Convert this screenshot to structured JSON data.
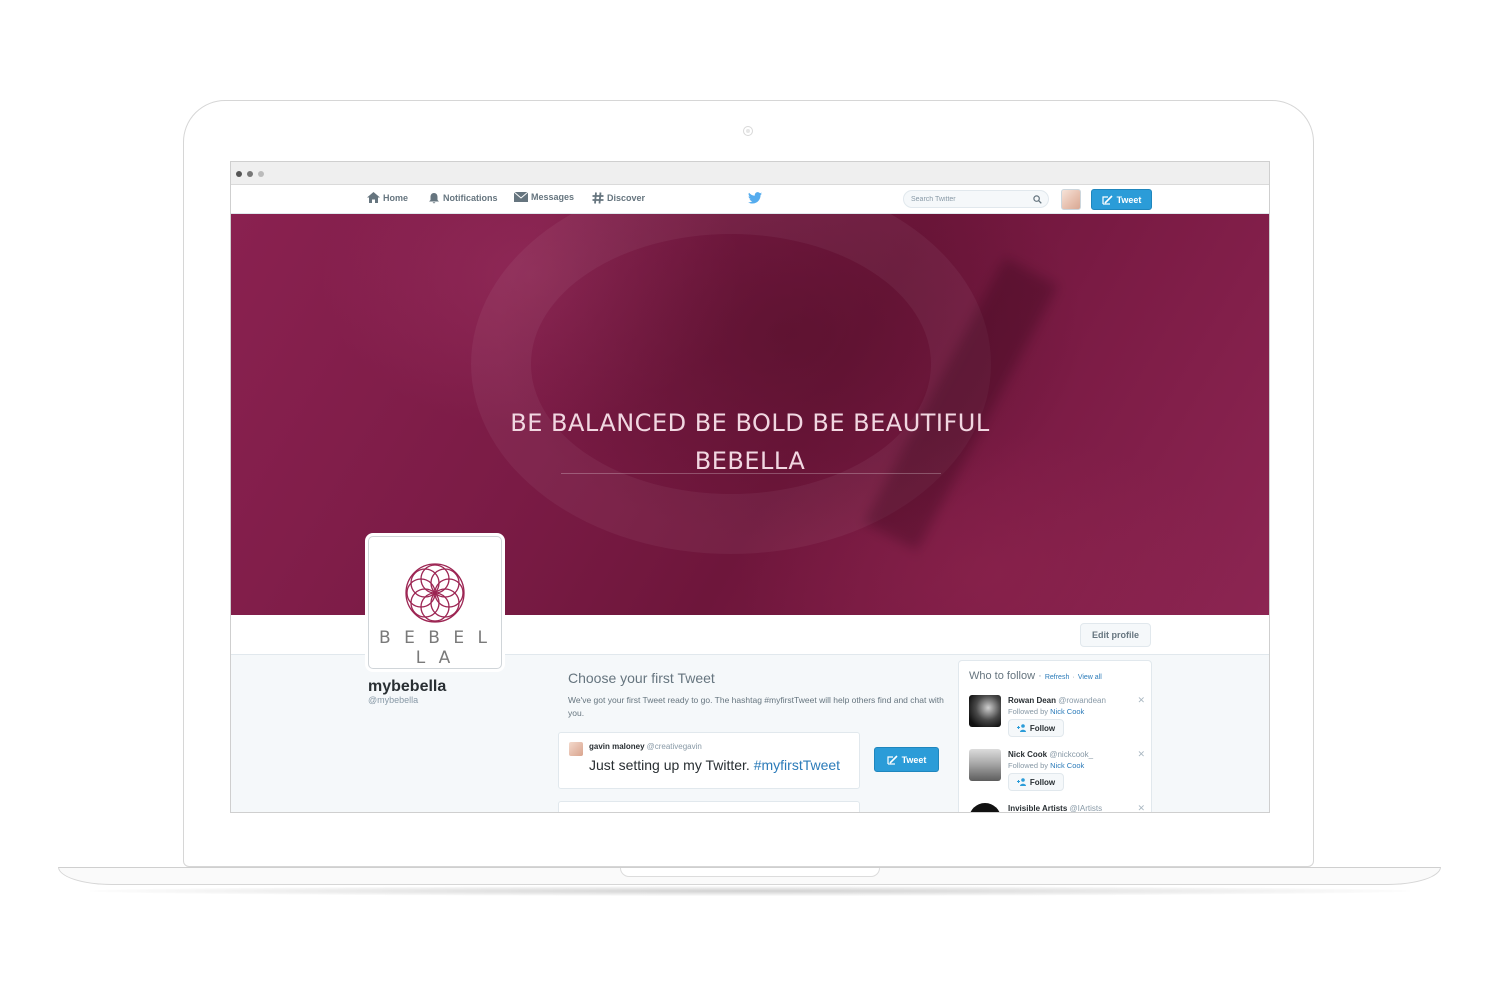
{
  "nav": {
    "home": "Home",
    "notifications": "Notifications",
    "messages": "Messages",
    "discover": "Discover",
    "search_placeholder": "Search Twitter",
    "tweet_button": "Tweet"
  },
  "header": {
    "line1": "BE BALANCED BE BOLD BE BEAUTIFUL",
    "line2": "BEBELLA"
  },
  "profile": {
    "logo_text": "BEBELLA",
    "name": "mybebella",
    "handle": "@mybebella",
    "edit_profile": "Edit profile"
  },
  "first_tweet": {
    "title": "Choose your first Tweet",
    "description": "We've got your first Tweet ready to go. The hashtag #myfirstTweet will help others find and chat with you.",
    "author_name": "gavin maloney",
    "author_handle": "@creativegavin",
    "text": "Just setting up my Twitter.",
    "hashtag": "#myfirstTweet",
    "tweet_button": "Tweet"
  },
  "who_to_follow": {
    "title": "Who to follow",
    "refresh": "Refresh",
    "view_all": "View all",
    "follow_label": "Follow",
    "followed_by_label": "Followed by",
    "suggestions": [
      {
        "name": "Rowan Dean",
        "handle": "@rowandean",
        "followed_by": "Nick Cook"
      },
      {
        "name": "Nick Cook",
        "handle": "@nickcook_",
        "followed_by": "Nick Cook"
      },
      {
        "name": "Invisible Artists",
        "handle": "@IArtists"
      }
    ]
  },
  "colors": {
    "accent": "#2b9cd8",
    "header_bg": "#7a1b45",
    "link": "#2b7bb9"
  }
}
